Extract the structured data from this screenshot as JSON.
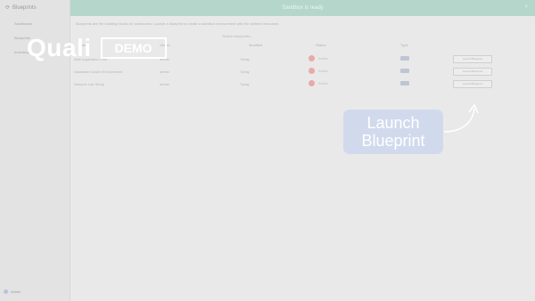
{
  "sidebar": {
    "title": "Blueprints",
    "items": [
      {
        "label": "Sandboxes"
      },
      {
        "label": "Blueprints"
      },
      {
        "label": "Inventory"
      }
    ],
    "footer": "Admin"
  },
  "banner": {
    "text": "Sandbox is ready",
    "close": "×"
  },
  "main": {
    "description": "Blueprints are the building blocks for sandboxes. Launch a blueprint to create a sandbox environment with the defined resources.",
    "search_placeholder": "Search blueprints..."
  },
  "table": {
    "headers": {
      "name": "Name",
      "owner": "Owner",
      "modified": "Modified",
      "status": "Status",
      "type": "Type",
      "action": ""
    },
    "rows": [
      {
        "name": "Web Application Test",
        "owner": "admin",
        "modified": "Today",
        "status": "Active",
        "action": "Launch Blueprint"
      },
      {
        "name": "Database Cluster Environment",
        "owner": "admin",
        "modified": "Today",
        "status": "Active",
        "action": "Launch Blueprint"
      },
      {
        "name": "Network Lab Setup",
        "owner": "admin",
        "modified": "Today",
        "status": "Active",
        "action": "Launch Blueprint"
      }
    ]
  },
  "overlay": {
    "logo_word": "Quali",
    "logo_demo": "DEMO",
    "callout_line1": "Launch",
    "callout_line2": "Blueprint"
  },
  "colors": {
    "banner": "#b4d6cb",
    "callout": "#cbd6ee",
    "background": "#e9e9e9"
  }
}
